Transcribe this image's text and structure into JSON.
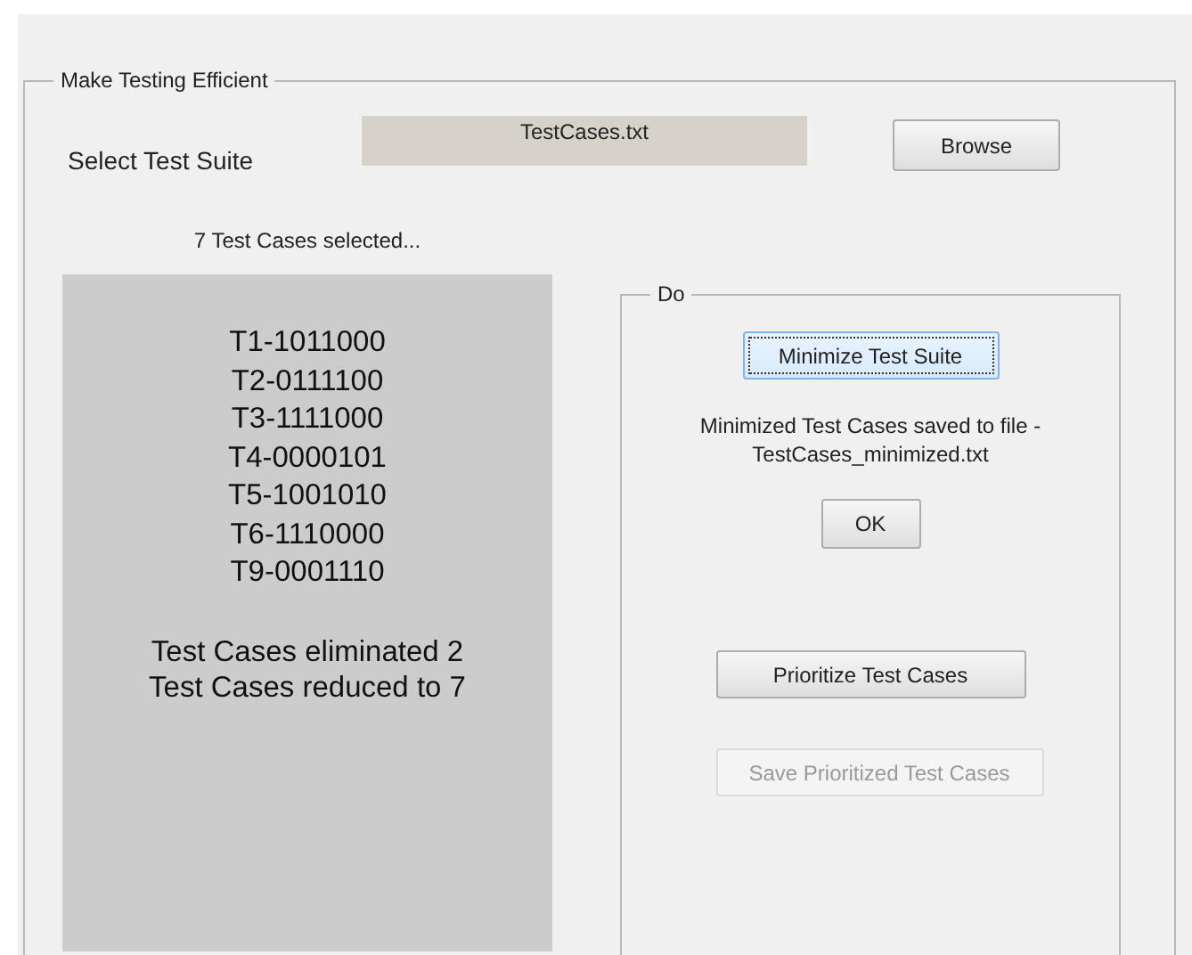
{
  "group": {
    "title": "Make Testing Efficient",
    "select_label": "Select Test Suite",
    "file_field": {
      "value": "TestCases.txt"
    },
    "browse_button": {
      "label": "Browse"
    },
    "selection_status": "7 Test Cases selected...",
    "results": {
      "lines": [
        "T1-1011000",
        "T2-0111100",
        "T3-1111000",
        "T4-0000101",
        "T5-1001010",
        "T6-1110000",
        "T9-0001110"
      ],
      "summary": [
        "Test Cases eliminated 2",
        "Test Cases reduced to 7"
      ]
    },
    "do_group": {
      "title": "Do",
      "items": [
        {
          "kind": "button",
          "label": "Minimize Test Suite",
          "focused": true,
          "disabled": false
        },
        {
          "kind": "message",
          "lines": [
            "Minimized Test Cases saved to file -",
            "TestCases_minimized.txt"
          ]
        },
        {
          "kind": "button",
          "label": "OK",
          "focused": false,
          "disabled": false
        },
        {
          "kind": "button",
          "label": "Prioritize Test Cases",
          "focused": false,
          "disabled": false
        },
        {
          "kind": "button",
          "label": "Save Prioritized Test Cases",
          "focused": false,
          "disabled": true
        }
      ]
    }
  }
}
